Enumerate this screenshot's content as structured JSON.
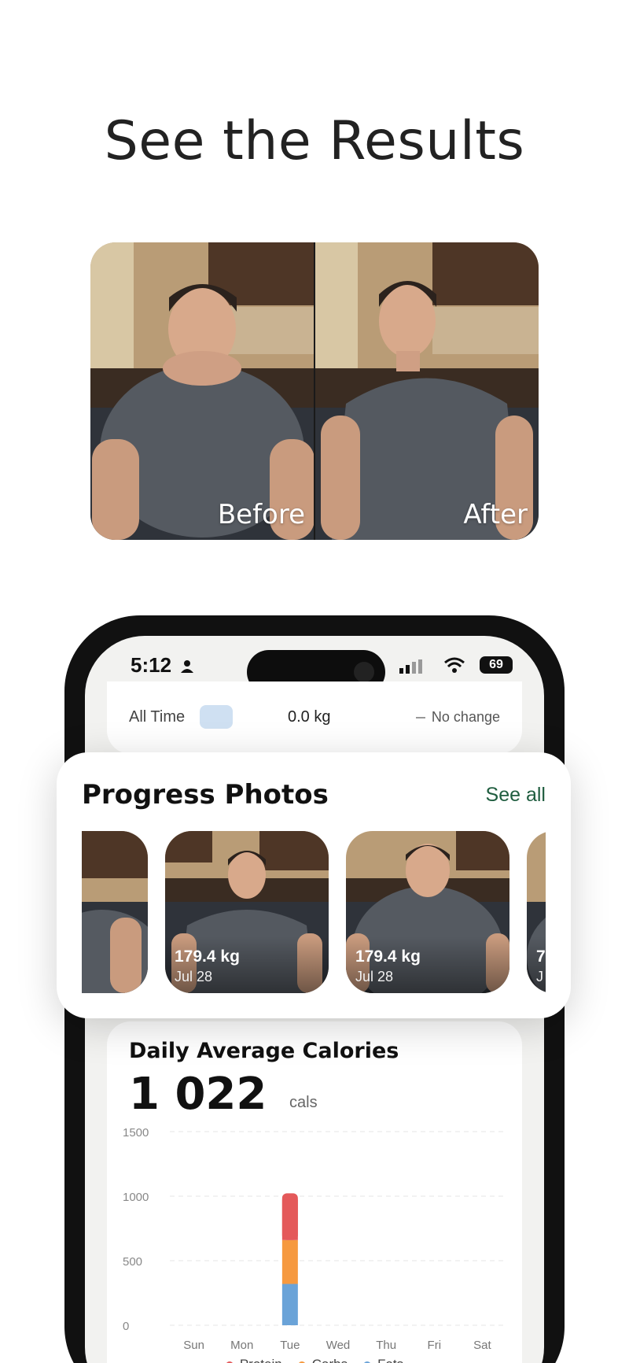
{
  "headline": "See the Results",
  "comparison": {
    "before_label": "Before",
    "after_label": "After"
  },
  "status_bar": {
    "time": "5:12",
    "battery": "69"
  },
  "weight_summary": {
    "range_label": "All Time",
    "value": "0.0 kg",
    "change_text": "No change"
  },
  "progress_photos": {
    "title": "Progress Photos",
    "see_all": "See all",
    "photos": [
      {
        "weight": "179.4 kg",
        "date": "Jul 28"
      },
      {
        "weight": "179.4 kg",
        "date": "Jul 28"
      }
    ],
    "partial_next_weight": "7",
    "partial_next_date": "J"
  },
  "calories": {
    "title": "Daily Average Calories",
    "value": "1 022",
    "unit": "cals"
  },
  "chart_data": {
    "type": "bar",
    "stacked": true,
    "categories": [
      "Sun",
      "Mon",
      "Tue",
      "Wed",
      "Thu",
      "Fri",
      "Sat"
    ],
    "series": [
      {
        "name": "Protein",
        "color": "#e4595a",
        "values": [
          0,
          0,
          362,
          0,
          0,
          0,
          0
        ]
      },
      {
        "name": "Carbs",
        "color": "#f6993f",
        "values": [
          0,
          0,
          340,
          0,
          0,
          0,
          0
        ]
      },
      {
        "name": "Fats",
        "color": "#6aa3d8",
        "values": [
          0,
          0,
          320,
          0,
          0,
          0,
          0
        ]
      }
    ],
    "y_ticks": [
      "1500",
      "1000",
      "500",
      "0"
    ],
    "ylim": [
      0,
      1500
    ],
    "grid": true,
    "legend_position": "bottom"
  }
}
